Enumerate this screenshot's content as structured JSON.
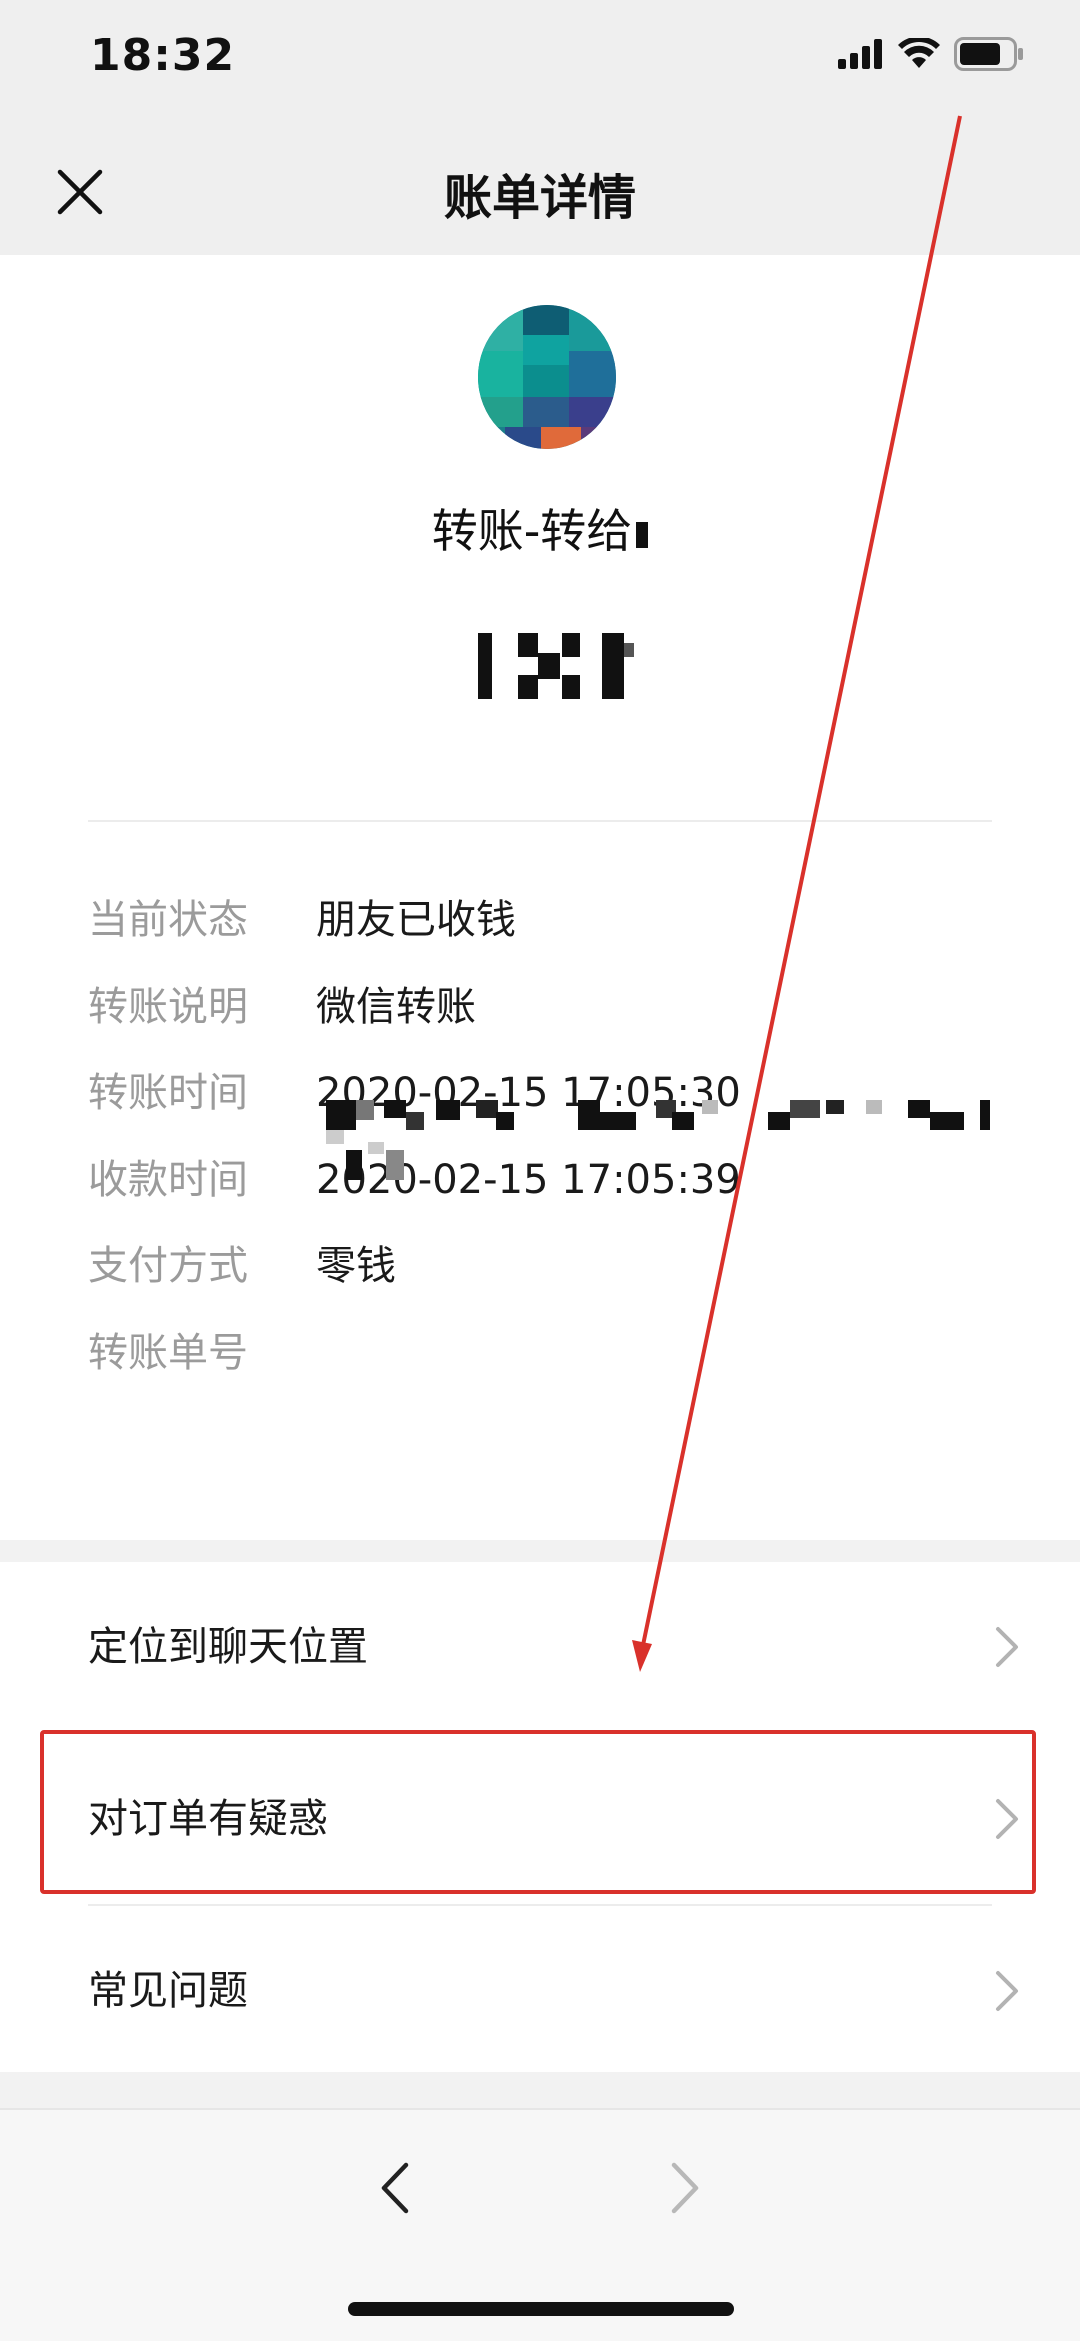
{
  "status_bar": {
    "time": "18:32",
    "icons": [
      "signal-icon",
      "wifi-icon",
      "battery-icon"
    ]
  },
  "header": {
    "title": "账单详情",
    "close_icon": "close-icon"
  },
  "transfer": {
    "title": "转账-转给"
  },
  "details": [
    {
      "label": "当前状态",
      "value": "朋友已收钱"
    },
    {
      "label": "转账说明",
      "value": "微信转账"
    },
    {
      "label": "转账时间",
      "value": "2020-02-15 17:05:30"
    },
    {
      "label": "收款时间",
      "value": "2020-02-15 17:05:39"
    },
    {
      "label": "支付方式",
      "value": "零钱"
    },
    {
      "label": "转账单号",
      "value": ""
    }
  ],
  "menu": [
    {
      "label": "定位到聊天位置"
    },
    {
      "label": "对订单有疑惑"
    },
    {
      "label": "常见问题"
    }
  ],
  "colors": {
    "background": "#f2f2f2",
    "card": "#ffffff",
    "label_gray": "#9b9b9b",
    "highlight_red": "#d9312b"
  }
}
